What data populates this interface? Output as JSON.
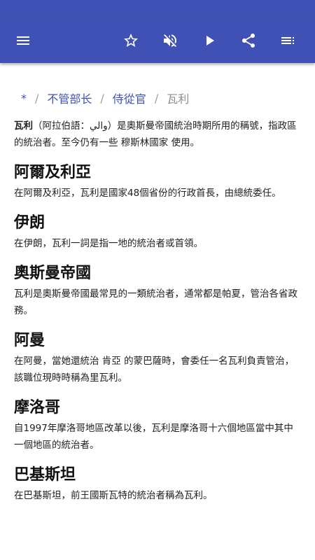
{
  "toolbar": {
    "icons": [
      "menu-icon",
      "star-icon",
      "volume-off-icon",
      "play-icon",
      "share-icon",
      "toc-icon"
    ],
    "color": "#3f51b5"
  },
  "breadcrumb": {
    "items": [
      "*",
      "不管部长",
      "侍從官"
    ],
    "current": "瓦利",
    "separator": "/"
  },
  "intro": {
    "term": "瓦利",
    "text": "（阿拉伯語：والي）是奧斯曼帝國統治時期所用的稱號，指政區的統治者。至今仍有一些 穆斯林國家 使用。"
  },
  "sections": [
    {
      "title": "阿爾及利亞",
      "body": "在阿爾及利亞，瓦利是國家48個省份的行政首長，由總統委任。"
    },
    {
      "title": "伊朗",
      "body": "在伊朗，瓦利一詞是指一地的統治者或首領。"
    },
    {
      "title": "奧斯曼帝國",
      "body": "瓦利是奧斯曼帝國最常見的一類統治者，通常都是帕夏，管治各省政務。"
    },
    {
      "title": "阿曼",
      "body": "在阿曼，當她還統治 肯亞 的蒙巴薩時，會委任一名瓦利負責管治，該職位現時時稱為里瓦利。"
    },
    {
      "title": "摩洛哥",
      "body": "自1997年摩洛哥地區改革以後，瓦利是摩洛哥十六個地區當中其中一個地區的統治者。"
    },
    {
      "title": "巴基斯坦",
      "body": "在巴基斯坦，前王國斯瓦特的統治者稱為瓦利。"
    }
  ]
}
